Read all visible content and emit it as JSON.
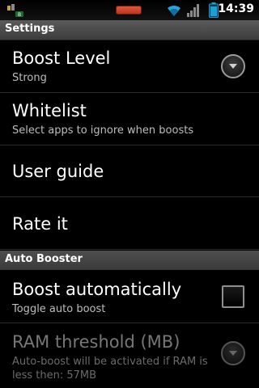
{
  "statusbar": {
    "time": "14:39",
    "icons": [
      "notification-icon",
      "battery-indicator-icon",
      "wifi-icon",
      "signal-icon",
      "battery-icon"
    ],
    "colors": {
      "battery_indicator": "#d1442a",
      "battery": "#1e9fd1",
      "wifi": "#24a7e0"
    }
  },
  "titlebar": {
    "title": "Settings"
  },
  "prefs": [
    {
      "title": "Boost Level",
      "summary": "Strong",
      "widget": "dropdown"
    },
    {
      "title": "Whitelist",
      "summary": "Select apps to ignore when boosts"
    },
    {
      "title": "User guide"
    },
    {
      "title": "Rate it"
    }
  ],
  "section_auto": {
    "title": "Auto Booster"
  },
  "auto_prefs": [
    {
      "title": "Boost automatically",
      "summary": "Toggle auto boost",
      "widget": "checkbox",
      "checked": false
    },
    {
      "title": "RAM threshold (MB)",
      "summary": "Auto-boost will be activated if RAM is less then: 57MB",
      "widget": "dropdown",
      "enabled": false
    }
  ]
}
